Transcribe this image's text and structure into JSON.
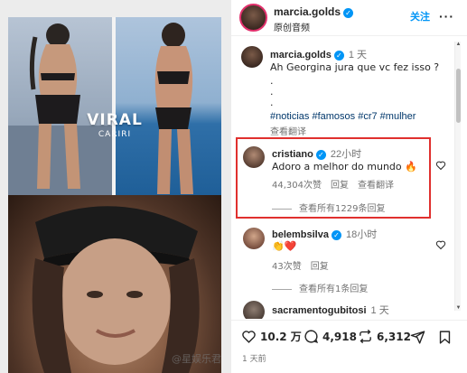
{
  "post": {
    "username": "marcia.golds",
    "subtitle": "原创音频",
    "follow_label": "关注",
    "more_label": "···",
    "media_overlay_title": "VIRAL",
    "media_overlay_subtitle": "CARIRI"
  },
  "caption": {
    "username": "marcia.golds",
    "time": "1 天",
    "text": "Ah Georgina jura que vc fez isso ?",
    "dot1": ".",
    "dot2": ".",
    "dot3": ".",
    "hashtags": "#noticias #famosos #cr7 #mulher",
    "translate": "查看翻译"
  },
  "comments": [
    {
      "username": "cristiano",
      "time": "22小时",
      "text": "Adoro a melhor do mundo 🔥",
      "likes": "44,304次赞",
      "reply": "回复",
      "translate": "查看翻译",
      "view_replies": "查看所有1229条回复",
      "highlighted": true
    },
    {
      "username": "belembsilva",
      "time": "18小时",
      "text": "👏❤️",
      "likes": "43次赞",
      "reply": "回复",
      "view_replies": "查看所有1条回复"
    },
    {
      "username": "sacramentogubitosi",
      "time": "1 天",
      "text": ""
    }
  ],
  "actions": {
    "likes": "10.2 万",
    "comments": "4,918",
    "reposts": "6,312"
  },
  "posted_ago": "1 天前",
  "watermark": "@星娱乐君",
  "icons": [
    "verified-badge-icon",
    "more-icon",
    "heart-icon",
    "comment-icon",
    "repost-icon",
    "share-icon",
    "bookmark-icon"
  ],
  "colors": {
    "link": "#0095f6",
    "hashtag": "#00376b",
    "highlight": "#e0302e",
    "muted": "#737373"
  }
}
